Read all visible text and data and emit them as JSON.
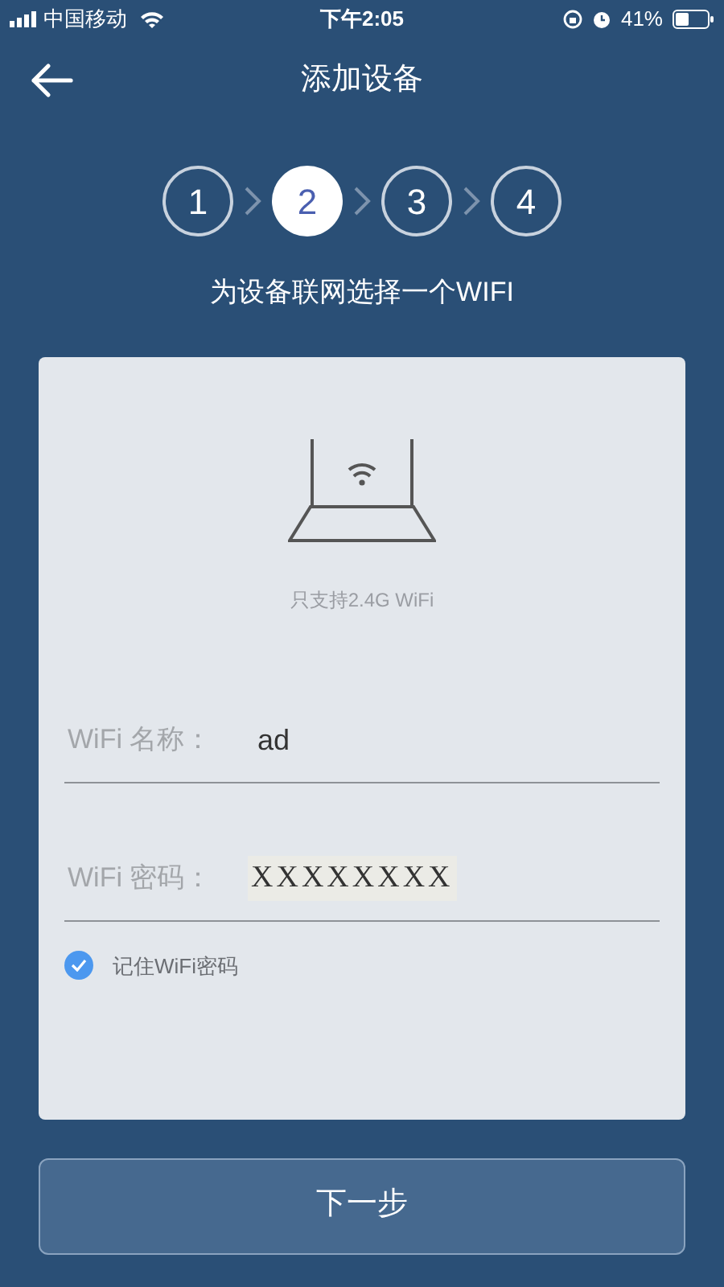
{
  "status_bar": {
    "carrier": "中国移动",
    "time": "下午2:05",
    "battery": "41%"
  },
  "header": {
    "title": "添加设备"
  },
  "steps": [
    {
      "label": "1",
      "selected": false
    },
    {
      "label": "2",
      "selected": true
    },
    {
      "label": "3",
      "selected": false
    },
    {
      "label": "4",
      "selected": false
    }
  ],
  "subtitle": "为设备联网选择一个WIFI",
  "card": {
    "note": "只支持2.4G WiFi",
    "fields": [
      {
        "label": "WiFi 名称：",
        "value": "ad",
        "kind": "text"
      },
      {
        "label": "WiFi 密码：",
        "value": "XXXXXXXX",
        "kind": "password"
      }
    ],
    "remember": {
      "label": "记住WiFi密码",
      "checked": true
    }
  },
  "next_button": "下一步"
}
